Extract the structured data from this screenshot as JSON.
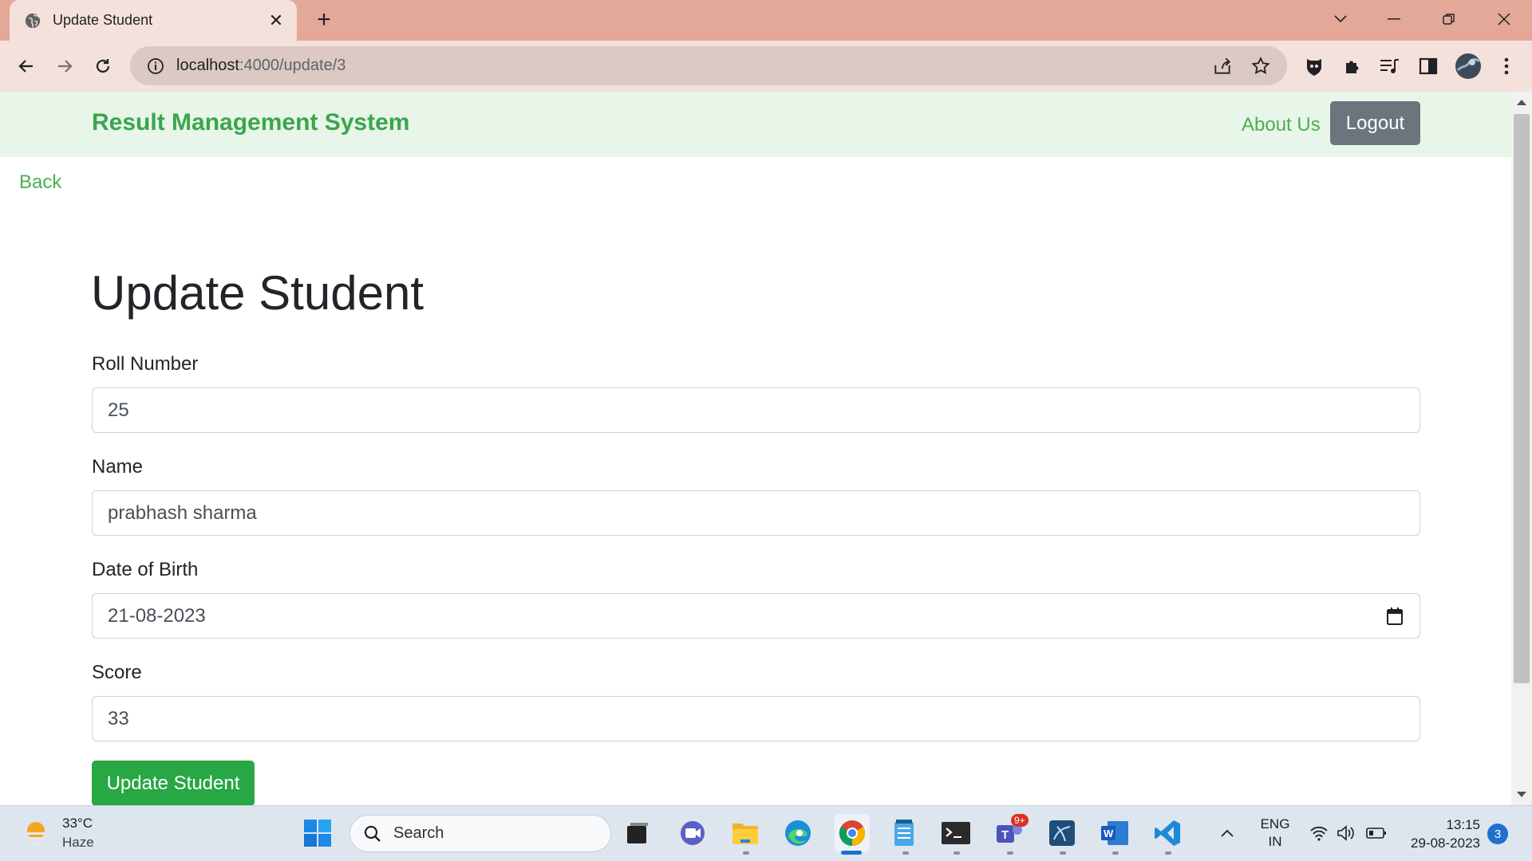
{
  "browser": {
    "tab_title": "Update Student",
    "url_host": "localhost",
    "url_path": ":4000/update/3"
  },
  "navbar": {
    "brand": "Result Management System",
    "about": "About Us",
    "logout": "Logout"
  },
  "page": {
    "back": "Back",
    "heading": "Update Student",
    "fields": {
      "roll": {
        "label": "Roll Number",
        "value": "25"
      },
      "name": {
        "label": "Name",
        "value": "prabhash sharma"
      },
      "dob": {
        "label": "Date of Birth",
        "value": "21-08-2023"
      },
      "score": {
        "label": "Score",
        "value": "33"
      }
    },
    "submit": "Update Student"
  },
  "taskbar": {
    "weather_temp": "33°C",
    "weather_desc": "Haze",
    "search": "Search",
    "teams_badge": "9+",
    "lang_line1": "ENG",
    "lang_line2": "IN",
    "time": "13:15",
    "date": "29-08-2023",
    "notifications": "3"
  },
  "colors": {
    "brand_green": "#3aa64c",
    "submit_green": "#28a745",
    "logout_gray": "#6c757d",
    "navbar_bg": "#e8f5e9"
  }
}
